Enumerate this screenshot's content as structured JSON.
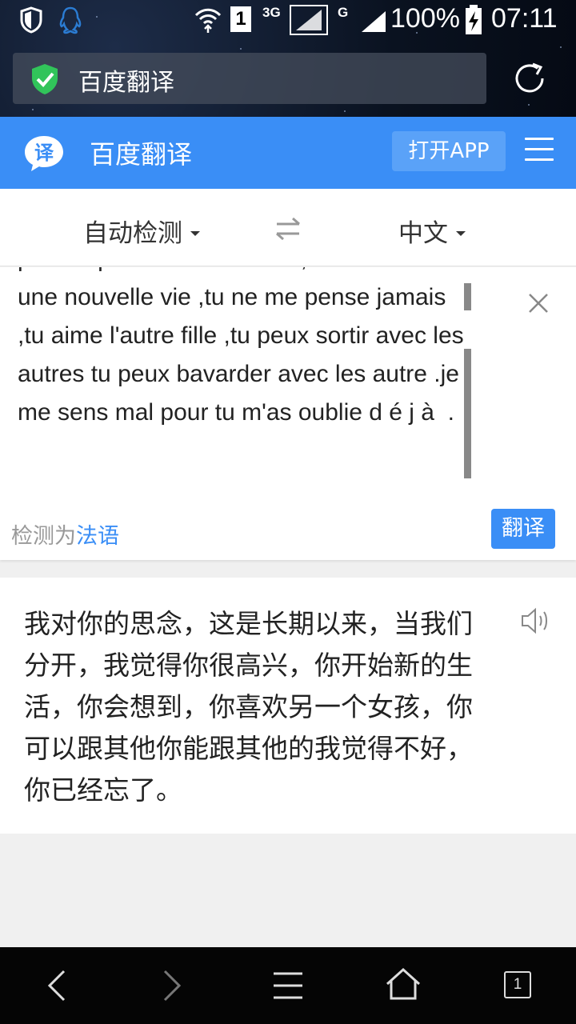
{
  "status_bar": {
    "sim_label": "1",
    "network_3g": "3G",
    "network_g": "G",
    "battery": "100%",
    "time": "07:11"
  },
  "browser": {
    "url_title": "百度翻译",
    "icons": [
      "shield-check-icon",
      "refresh-icon"
    ]
  },
  "header": {
    "brand": "百度翻译",
    "logo_glyph": "译",
    "open_app_label": "打开APP",
    "brand_color": "#3a8ef6"
  },
  "lang_select": {
    "source": "自动检测",
    "target": "中文"
  },
  "input": {
    "text": "pense que tu est contente ,tu commence une nouvelle vie ,tu ne me pense jamais ,tu aime l'autre fille ,tu peux sortir avec les autres tu peux bavarder avec les autre .je me sens mal pour tu m'as oublie d é j à  .",
    "detect_prefix": "检测为",
    "detect_lang": "法语",
    "translate_label": "翻译"
  },
  "output": {
    "text": "我对你的思念，这是长期以来，当我们分开，我觉得你很高兴，你开始新的生活，你会想到，你喜欢另一个女孩，你可以跟其他你能跟其他的我觉得不好，你已经忘了。"
  },
  "bottom_nav": {
    "tab_count": "1"
  }
}
